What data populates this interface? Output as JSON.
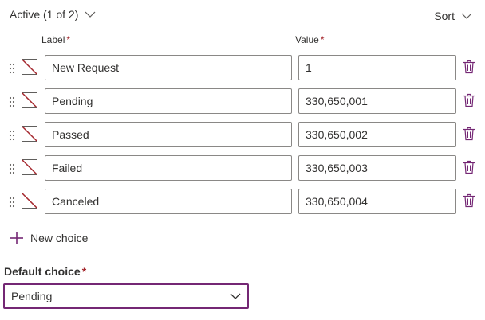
{
  "header": {
    "title": "Active (1 of 2)",
    "sort_label": "Sort"
  },
  "columns": {
    "label": "Label",
    "value": "Value",
    "required_marker": "*"
  },
  "choices": [
    {
      "label": "New Request",
      "value": "1"
    },
    {
      "label": "Pending",
      "value": "330,650,001"
    },
    {
      "label": "Passed",
      "value": "330,650,002"
    },
    {
      "label": "Failed",
      "value": "330,650,003"
    },
    {
      "label": "Canceled",
      "value": "330,650,004"
    }
  ],
  "new_choice_label": "New choice",
  "default_choice": {
    "label": "Default choice",
    "required_marker": "*",
    "selected": "Pending"
  },
  "colors": {
    "accent": "#742774",
    "required": "#a4262c",
    "swatch_line": "#a4262c",
    "border": "#8a8886",
    "text": "#323130"
  },
  "icons": {
    "header_toggle": "chevron-down-icon",
    "sort": "chevron-down-icon",
    "drag": "drag-handle-icon",
    "color": "no-color-icon",
    "delete": "trash-icon",
    "add": "plus-icon",
    "dropdown": "chevron-down-icon"
  }
}
